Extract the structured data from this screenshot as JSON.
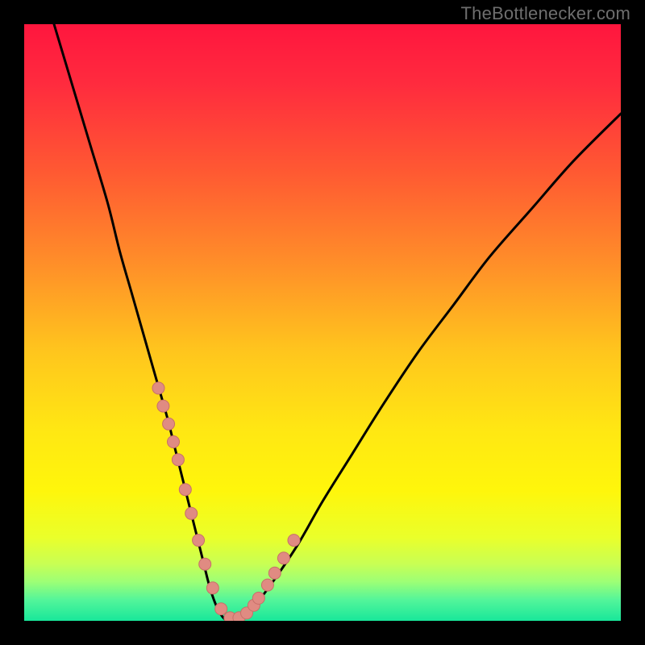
{
  "watermark": "TheBottlenecker.com",
  "colors": {
    "frame": "#000000",
    "gradient_stops": [
      {
        "offset": 0.0,
        "color": "#ff163e"
      },
      {
        "offset": 0.1,
        "color": "#ff2b3e"
      },
      {
        "offset": 0.25,
        "color": "#ff5a32"
      },
      {
        "offset": 0.4,
        "color": "#ff8e29"
      },
      {
        "offset": 0.55,
        "color": "#ffc61d"
      },
      {
        "offset": 0.68,
        "color": "#ffe713"
      },
      {
        "offset": 0.78,
        "color": "#fff60b"
      },
      {
        "offset": 0.86,
        "color": "#eaff2a"
      },
      {
        "offset": 0.905,
        "color": "#c8ff54"
      },
      {
        "offset": 0.935,
        "color": "#9cff76"
      },
      {
        "offset": 0.965,
        "color": "#53f59a"
      },
      {
        "offset": 1.0,
        "color": "#18e79a"
      }
    ],
    "curve": "#000000",
    "marker_fill": "#e08b82",
    "marker_stroke": "#c77068"
  },
  "chart_data": {
    "type": "line",
    "title": "",
    "xlabel": "",
    "ylabel": "",
    "xlim": [
      0,
      100
    ],
    "ylim": [
      0,
      100
    ],
    "grid": false,
    "legend": false,
    "series": [
      {
        "name": "bottleneck-curve",
        "x": [
          5,
          8,
          11,
          14,
          16,
          18,
          20,
          22,
          24,
          25,
          26,
          27,
          28,
          29,
          30,
          31,
          32,
          33,
          34,
          35,
          37,
          39,
          42,
          46,
          50,
          55,
          60,
          66,
          72,
          78,
          85,
          92,
          100
        ],
        "y": [
          100,
          90,
          80,
          70,
          62,
          55,
          48,
          41,
          34,
          30,
          26,
          22,
          18,
          14,
          10,
          6,
          3,
          1,
          0,
          0,
          1,
          3,
          7,
          13,
          20,
          28,
          36,
          45,
          53,
          61,
          69,
          77,
          85
        ]
      }
    ],
    "markers": {
      "name": "highlight-points",
      "x": [
        22.5,
        23.3,
        24.2,
        25.0,
        25.8,
        27.0,
        28.0,
        29.2,
        30.3,
        31.6,
        33.0,
        34.5,
        36.0,
        37.3,
        38.5,
        39.3,
        40.8,
        42.0,
        43.5,
        45.2
      ],
      "y": [
        39,
        36,
        33,
        30,
        27,
        22,
        18,
        13.5,
        9.5,
        5.5,
        2,
        0.5,
        0.5,
        1.3,
        2.6,
        3.8,
        6.0,
        8.0,
        10.5,
        13.5
      ]
    }
  }
}
